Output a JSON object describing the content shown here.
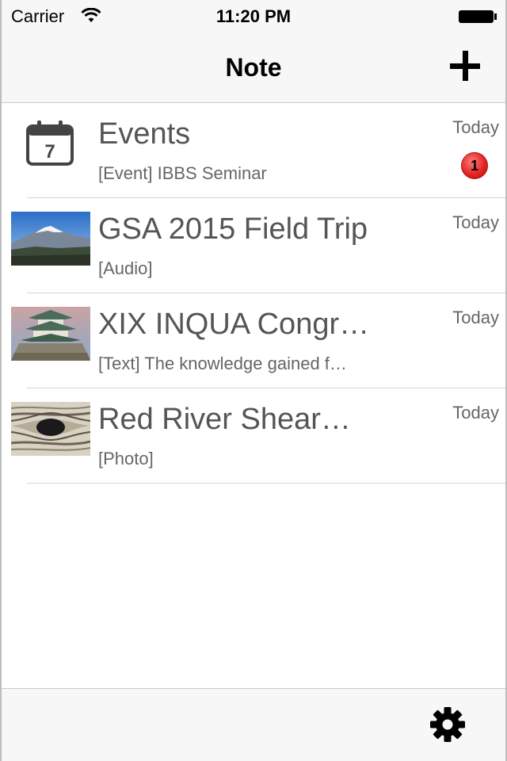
{
  "status_bar": {
    "carrier": "Carrier",
    "time": "11:20 PM",
    "wifi_icon": "wifi-icon",
    "battery_icon": "battery-icon"
  },
  "nav_bar": {
    "title": "Note",
    "add_icon": "plus-icon"
  },
  "notes": [
    {
      "title": "Events",
      "subtitle": "[Event] IBBS Seminar",
      "date": "Today",
      "badge": "1",
      "icon": "calendar-icon"
    },
    {
      "title": "GSA 2015 Field Trip",
      "subtitle": "[Audio]",
      "date": "Today",
      "icon": "mountain-photo-thumbnail"
    },
    {
      "title": "XIX INQUA Congr…",
      "subtitle": "[Text] The knowledge gained f…",
      "date": "Today",
      "icon": "castle-photo-thumbnail"
    },
    {
      "title": "Red River Shear…",
      "subtitle": "[Photo]",
      "date": "Today",
      "icon": "rock-photo-thumbnail"
    }
  ],
  "calendar_icon_day": "7",
  "toolbar": {
    "settings_icon": "gear-icon"
  },
  "colors": {
    "bar_background": "#f7f7f7",
    "separator": "#d6d6d6",
    "badge_red": "#e0201e",
    "text_gray": "#555555"
  }
}
